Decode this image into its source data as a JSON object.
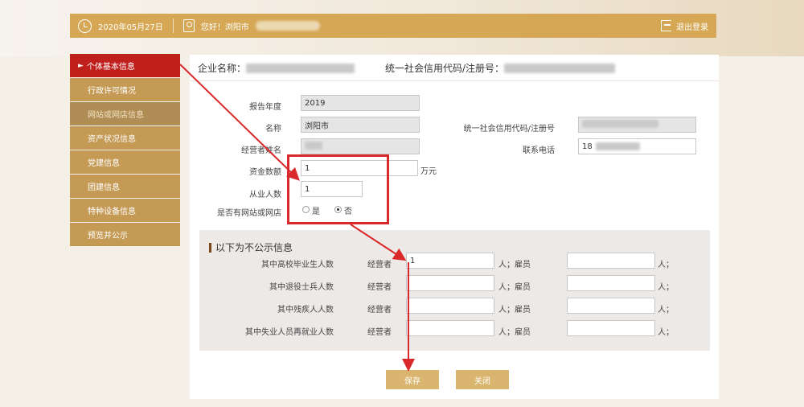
{
  "topbar": {
    "date": "2020年05月27日",
    "greeting": "您好！浏阳市",
    "logout": "退出登录"
  },
  "sidebar": {
    "items": [
      {
        "label": "个体基本信息"
      },
      {
        "label": "行政许可情况"
      },
      {
        "label": "网站或网店信息"
      },
      {
        "label": "资产状况信息"
      },
      {
        "label": "党建信息"
      },
      {
        "label": "团建信息"
      },
      {
        "label": "特种设备信息"
      },
      {
        "label": "预览并公示"
      }
    ]
  },
  "header": {
    "company_label": "企业名称：",
    "credit_label": "统一社会信用代码/注册号："
  },
  "form": {
    "year_label": "报告年度",
    "year_value": "2019",
    "name_label": "名称",
    "name_value": "浏阳市",
    "credit_label": "统一社会信用代码/注册号",
    "operator_label": "经营者姓名",
    "phone_label": "联系电话",
    "phone_value": "18",
    "capital_label": "资金数额",
    "capital_value": "1",
    "capital_unit": "万元",
    "staff_label": "从业人数",
    "staff_value": "1",
    "website_label": "是否有网站或网店",
    "website_yes": "是",
    "website_no": "否",
    "website_selected": "否"
  },
  "private": {
    "title": "以下为不公示信息",
    "operator_label": "经营者",
    "employee_label": "人；雇员",
    "person_unit": "人；",
    "rows": [
      {
        "label": "其中高校毕业生人数",
        "operator_value": "1",
        "employee_value": ""
      },
      {
        "label": "其中退役士兵人数",
        "operator_value": "",
        "employee_value": ""
      },
      {
        "label": "其中残疾人人数",
        "operator_value": "",
        "employee_value": ""
      },
      {
        "label": "其中失业人员再就业人数",
        "operator_value": "",
        "employee_value": ""
      }
    ]
  },
  "buttons": {
    "save": "保存",
    "close": "关闭"
  },
  "colors": {
    "brand_gold": "#d6a855",
    "active_red": "#c0201c",
    "annotation_red": "#d9292a"
  }
}
